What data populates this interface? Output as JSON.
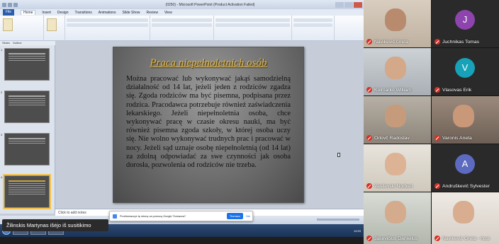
{
  "slide": {
    "title": "Praca niepełnoletnich osób",
    "body": "Można pracować lub wykonywać jakąś samodzielną działalność od 14 lat, jeżeli jeden z rodziców zgadza się. Zgoda rodziców ma być pisemna, podpisana przez rodzica. Pracodawca potrzebuje również zaświadczenia lekarskiego. Jeżeli niepełnoletnia osoba, chce wykonywać pracę w czasie okresu nauki, ma być również pisemna zgoda szkoły, w której osoba uczy się. Nie wolno wykonywać trudnych prac i pracować w nocy. Jeżeli sąd uznaje osobę niepełnoletnią (od 14 lat) za zdolną odpowiadać za swe czynności jak osoba dorosła, pozwolenia od rodziców nie trzeba."
  },
  "ppt": {
    "window_title": "(0250) - Microsoft PowerPoint (Product Activation Failed)",
    "tabs": [
      "File",
      "Home",
      "Insert",
      "Design",
      "Transitions",
      "Animations",
      "Slide Show",
      "Review",
      "View"
    ],
    "pane_tabs": [
      "Slides",
      "Outline"
    ],
    "slide_numbers": [
      "1",
      "2",
      "3",
      "4"
    ],
    "notes_placeholder": "Click to add notes",
    "taskbar_time": "14:53"
  },
  "translate_bar": {
    "message": "Przetłumaczyć tę stronę za pomocą Google Tłumacza?",
    "translate_label": "Tłumacz",
    "cancel_label": "Nie"
  },
  "toast": {
    "text": "Žilinskis Martynas išėjo iš susitikimo"
  },
  "participants": [
    {
      "name": "Navikevič Greta",
      "type": "video",
      "muted": true
    },
    {
      "name": "Juchnikas Tomas",
      "type": "avatar",
      "initial": "J",
      "color": "#8e44ad",
      "muted": true
    },
    {
      "name": "Kolmarko William",
      "type": "video",
      "muted": true
    },
    {
      "name": "Vlasovas Erik",
      "type": "avatar",
      "initial": "V",
      "color": "#17a2b8",
      "muted": true
    },
    {
      "name": "Orlovč Radoslav",
      "type": "video",
      "muted": true
    },
    {
      "name": "Varonis Aneta",
      "type": "video",
      "muted": true
    },
    {
      "name": "Vasilevski Norbert",
      "type": "video",
      "muted": true
    },
    {
      "name": "Andruškevič Sylvester",
      "type": "avatar",
      "initial": "A",
      "color": "#5c6bc0",
      "muted": true
    },
    {
      "name": "Jasevičius Danielius",
      "type": "video",
      "muted": true
    },
    {
      "name": "Navikevič Greta - host",
      "type": "video",
      "muted": true
    }
  ]
}
